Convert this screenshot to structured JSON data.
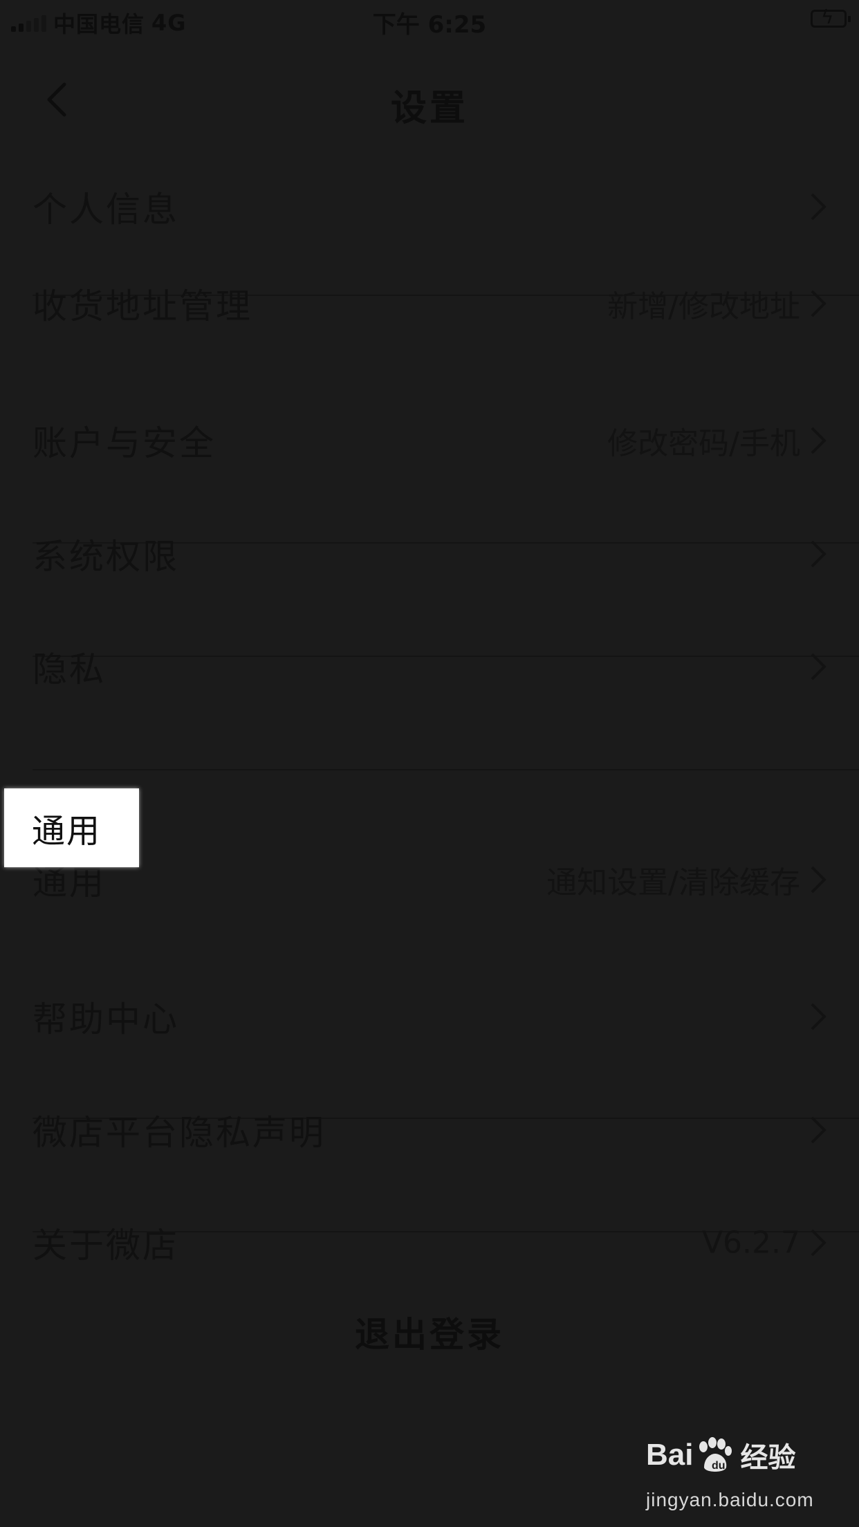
{
  "status_bar": {
    "carrier": "中国电信",
    "network": "4G",
    "time": "下午 6:25"
  },
  "nav": {
    "title": "设置",
    "back_icon": "chevron-left-icon"
  },
  "settings": {
    "items": [
      {
        "label": "个人信息",
        "value": ""
      },
      {
        "label": "收货地址管理",
        "value": "新增/修改地址"
      },
      {
        "label": "账户与安全",
        "value": "修改密码/手机"
      },
      {
        "label": "系统权限",
        "value": ""
      },
      {
        "label": "隐私",
        "value": ""
      },
      {
        "label": "通用",
        "value": "通知设置/清除缓存"
      },
      {
        "label": "帮助中心",
        "value": ""
      },
      {
        "label": "微店平台隐私声明",
        "value": ""
      },
      {
        "label": "关于微店",
        "value": "V6.2.7"
      }
    ]
  },
  "highlight": {
    "label": "通用"
  },
  "logout_label": "退出登录",
  "watermark": {
    "brand_left": "Bai",
    "brand_right": "经验",
    "url": "jingyan.baidu.com"
  },
  "colors": {
    "background": "#1b1b1b",
    "highlight": "#ffffff"
  }
}
